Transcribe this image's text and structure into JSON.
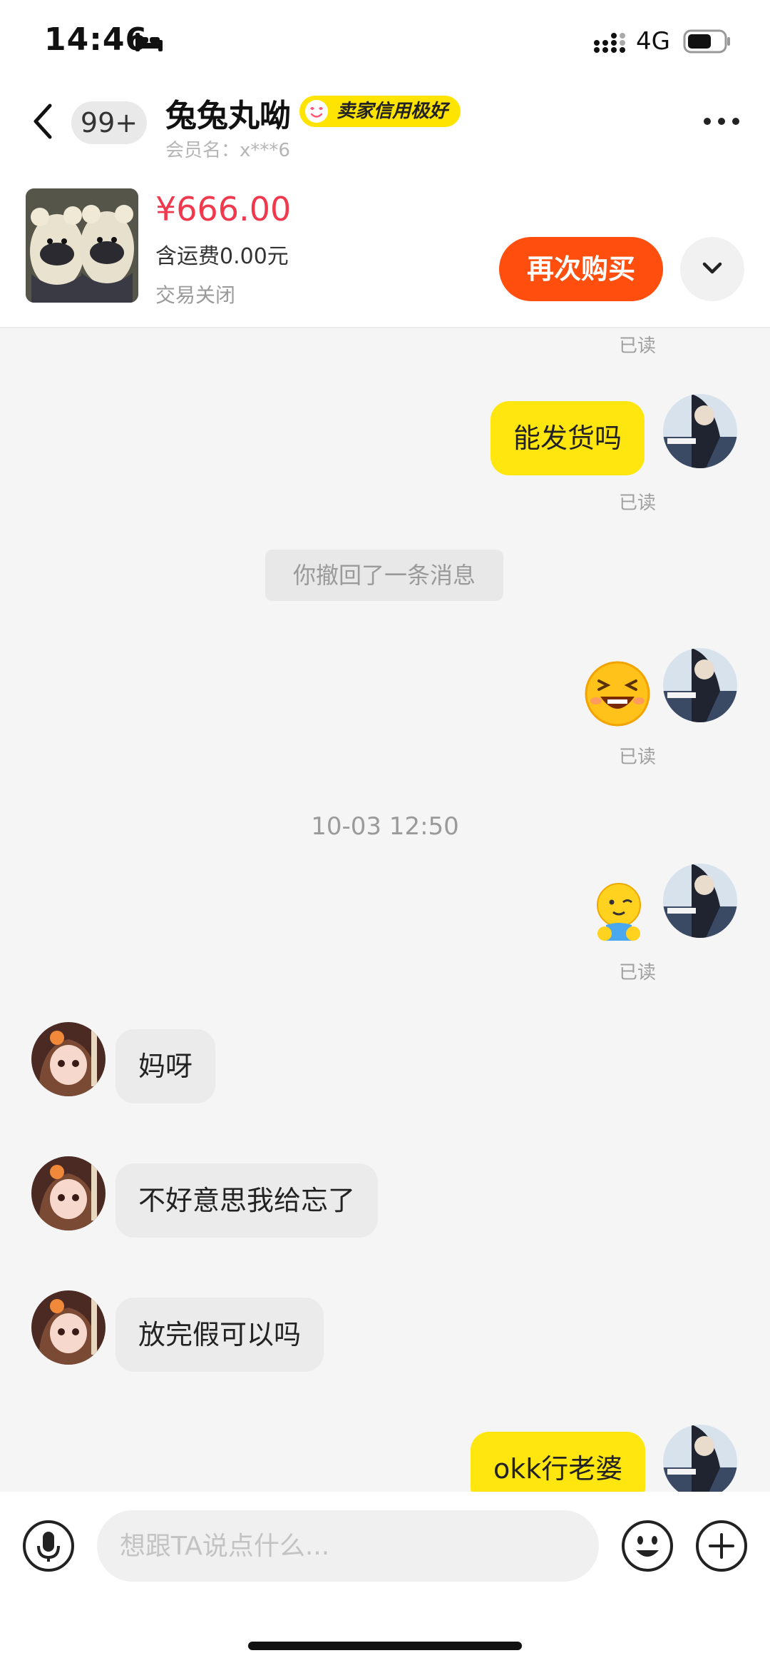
{
  "status_bar": {
    "time": "14:46",
    "network": "4G"
  },
  "header": {
    "unread_count": "99+",
    "contact_name": "兔兔丸呦",
    "credit_badge": "卖家信用极好",
    "member_label": "会员名：x***6"
  },
  "product": {
    "price": "¥666.00",
    "shipping": "含运费0.00元",
    "status": "交易关闭",
    "rebuy_label": "再次购买"
  },
  "chat": {
    "read_label": "已读",
    "msg_ship": "能发货吗",
    "recalled_notice": "你撤回了一条消息",
    "timestamp": "10-03 12:50",
    "msg_wow": "妈呀",
    "msg_sorry": "不好意思我给忘了",
    "msg_after_holiday": "放完假可以吗",
    "msg_ok": "okk行老婆"
  },
  "input": {
    "placeholder": "想跟TA说点什么..."
  },
  "colors": {
    "my_bubble": "#ffe60f",
    "their_bubble": "#ebebeb",
    "price": "#f0394c",
    "rebuy_button": "#ff4e0e",
    "credit_badge": "#ffe400"
  },
  "icons": {
    "back": "chevron-left-icon",
    "more": "more-dots-icon",
    "expand": "chevron-down-icon",
    "mic": "microphone-icon",
    "emoji": "emoji-icon",
    "plus": "plus-icon"
  }
}
